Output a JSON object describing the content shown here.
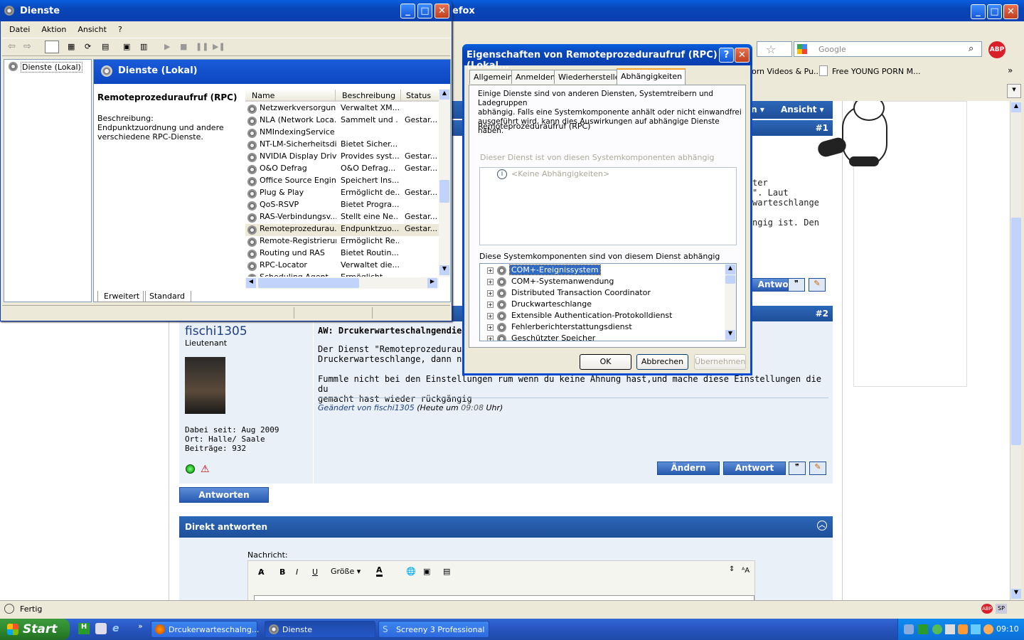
{
  "firefox": {
    "title": "efox",
    "search_placeholder": "Google",
    "bookmarks": [
      "orn Videos & Pu...",
      "Free YOUNG PORN M..."
    ],
    "status": "Fertig",
    "toolbar_menu": [
      "en ▾",
      "Ansicht ▾"
    ],
    "post1_no": "#1",
    "post1_tail": [
      "ter",
      "\". Laut",
      "warteschlange",
      "ngig ist. Den"
    ],
    "post1_buttons": {
      "reply": "Antwort"
    },
    "post2": {
      "no": "#2",
      "user": "fischi1305",
      "rank": "Lieutenant",
      "title": "AW: Drcukerwarteschalngendie",
      "text1": "Der Dienst \"Remoteprozeduraufr",
      "text2": "Druckerwarteschlange, dann neu",
      "text3": "Fummle nicht bei den Einstellungen rum wenn du keine Ahnung hast,und mache diese Einstellungen die du",
      "text4": "gemacht hast wieder rückgängig",
      "edited_by": "Geändert von fischi1305",
      "edited_time_pre": "(Heute um ",
      "edited_time": "09:08",
      "edited_time_post": " Uhr)",
      "since": "Dabei seit: Aug 2009",
      "location": "Ort: Halle/ Saale",
      "posts": "Beiträge: 932",
      "edit_btn": "Ändern",
      "reply_btn": "Antwort"
    },
    "answer_btn": "Antworten",
    "quick_reply": "Direkt antworten",
    "message_label": "Nachricht:",
    "size_label": "Größe"
  },
  "services": {
    "title": "Dienste",
    "menu": [
      "Datei",
      "Aktion",
      "Ansicht",
      "?"
    ],
    "tree_root": "Dienste (Lokal)",
    "header": "Dienste (Lokal)",
    "selected": "Remoteprozeduraufruf (RPC)",
    "desc_label": "Beschreibung:",
    "desc": [
      "Endpunktzuordnung und andere",
      "verschiedene RPC-Dienste."
    ],
    "columns": [
      "Name",
      "Beschreibung",
      "Status"
    ],
    "rows": [
      [
        "Netzwerkversorgun...",
        "Verwaltet XM...",
        ""
      ],
      [
        "NLA (Network Loca...",
        "Sammelt und ...",
        "Gestar..."
      ],
      [
        "NMIndexingService",
        "",
        ""
      ],
      [
        "NT-LM-Sicherheitsdi...",
        "Bietet Sicher...",
        ""
      ],
      [
        "NVIDIA Display Driv...",
        "Provides syst...",
        "Gestar..."
      ],
      [
        "O&O Defrag",
        "O&O Defrag...",
        "Gestar..."
      ],
      [
        "Office Source Engine",
        "Speichert Ins...",
        ""
      ],
      [
        "Plug & Play",
        "Ermöglicht de...",
        "Gestar..."
      ],
      [
        "QoS-RSVP",
        "Bietet Progra...",
        ""
      ],
      [
        "RAS-Verbindungsv...",
        "Stellt eine Ne...",
        "Gestar..."
      ],
      [
        "Remoteprozedurau...",
        "Endpunktzuo...",
        "Gestar..."
      ],
      [
        "Remote-Registrierung",
        "Ermöglicht Re...",
        ""
      ],
      [
        "Routing und RAS",
        "Bietet Routin...",
        ""
      ],
      [
        "RPC-Locator",
        "Verwaltet die...",
        ""
      ],
      [
        "Scheduling Agent...",
        "Ermöglicht...",
        ""
      ]
    ],
    "tabs": [
      "Erweitert",
      "Standard"
    ]
  },
  "dialog": {
    "title": "Eigenschaften von Remoteprozeduraufruf (RPC) (Lokal...",
    "tabs": [
      "Allgemein",
      "Anmelden",
      "Wiederherstellen",
      "Abhängigkeiten"
    ],
    "intro": [
      "Einige Dienste sind von anderen Diensten, Systemtreibern und Ladegruppen",
      "abhängig. Falls eine Systemkomponente anhält oder nicht einwandfrei",
      "ausgeführt wird, kann dies Auswirkungen auf abhängige Dienste haben."
    ],
    "service": "Remoteprozeduraufruf (RPC)",
    "depends_on_label": "Dieser Dienst ist von diesen Systemkomponenten abhängig",
    "none": "<Keine Abhängigkeiten>",
    "dependents_label": "Diese Systemkomponenten sind von diesem Dienst abhängig",
    "dependents": [
      "COM+-Ereignissystem",
      "COM+-Systemanwendung",
      "Distributed Transaction Coordinator",
      "Druckwarteschlange",
      "Extensible Authentication-Protokolldienst",
      "Fehlerberichterstattungsdienst",
      "Geschützter Speicher"
    ],
    "ok": "OK",
    "cancel": "Abbrechen",
    "apply": "Übernehmen"
  },
  "taskbar": {
    "start": "Start",
    "items": [
      "Drcukerwarteschalng...",
      "Dienste",
      "Screeny 3 Professional"
    ],
    "clock": "09:10"
  }
}
